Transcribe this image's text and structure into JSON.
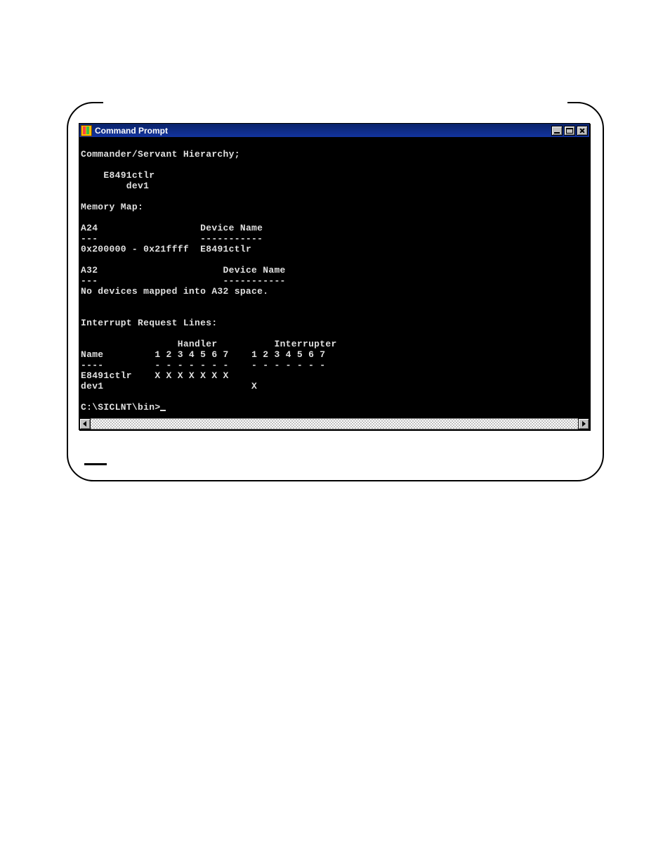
{
  "window": {
    "title": "Command Prompt"
  },
  "prompt": "C:\\SICLNT\\bin>",
  "terminal": {
    "hierarchy_heading": "Commander/Servant Hierarchy;",
    "hierarchy_lines": [
      "    E8491ctlr",
      "        dev1"
    ],
    "memory_map_heading": "Memory Map:",
    "a24_label": "A24",
    "a24_device_hdr": "Device Name",
    "a24_row": {
      "range": "0x200000 - 0x21ffff",
      "device": "E8491ctlr"
    },
    "a32_label": "A32",
    "a32_device_hdr": "Device Name",
    "a32_note": "No devices mapped into A32 space.",
    "irq_heading": "Interrupt Request Lines:",
    "irq_handler_hdr": "Handler",
    "irq_interrupter_hdr": "Interrupter",
    "irq_name_hdr": "Name",
    "irq_cols_handler": "1 2 3 4 5 6 7",
    "irq_cols_interrupter": "1 2 3 4 5 6 7",
    "irq_rows": [
      {
        "name": "E8491ctlr",
        "handler": "X X X X X X X",
        "interrupter": ""
      },
      {
        "name": "dev1",
        "handler": "",
        "interrupter": "X"
      }
    ]
  },
  "buttons": {
    "minimize": "Minimize",
    "maximize": "Maximize",
    "close": "Close",
    "scroll_left": "Scroll left",
    "scroll_right": "Scroll right"
  }
}
